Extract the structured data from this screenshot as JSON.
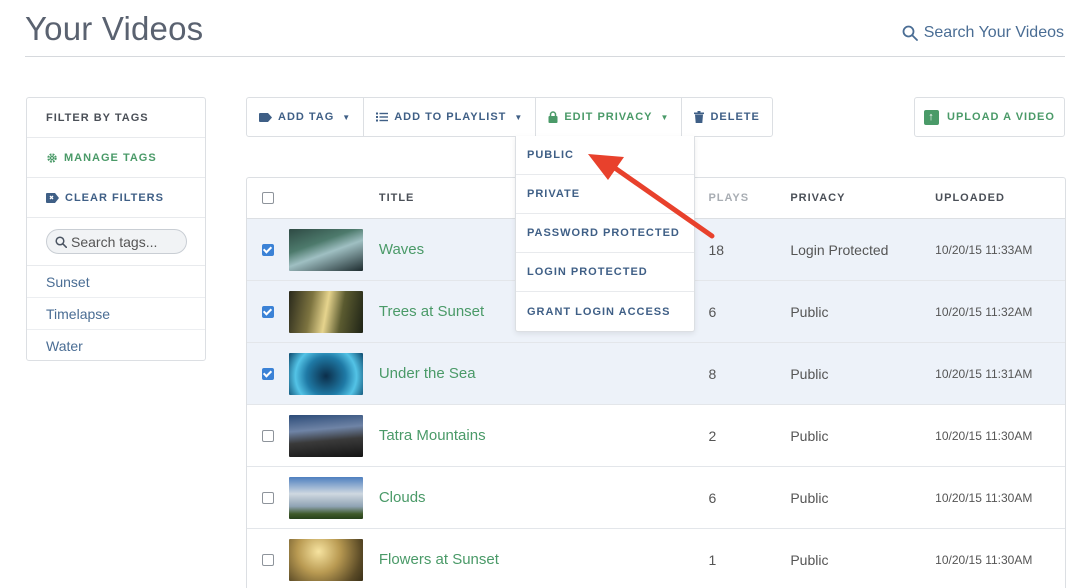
{
  "header": {
    "title": "Your Videos",
    "search_label": "Search Your Videos"
  },
  "sidebar": {
    "heading": "FILTER BY TAGS",
    "manage_tags": "MANAGE TAGS",
    "clear_filters": "CLEAR FILTERS",
    "search_placeholder": "Search tags...",
    "tags": [
      "Sunset",
      "Timelapse",
      "Water"
    ]
  },
  "toolbar": {
    "add_tag": "ADD TAG",
    "add_to_playlist": "ADD TO PLAYLIST",
    "edit_privacy": "EDIT PRIVACY",
    "delete": "DELETE",
    "upload": "UPLOAD A VIDEO"
  },
  "privacy_menu": {
    "items": [
      "PUBLIC",
      "PRIVATE",
      "PASSWORD PROTECTED",
      "LOGIN PROTECTED",
      "GRANT LOGIN ACCESS"
    ]
  },
  "table": {
    "headers": {
      "title": "TITLE",
      "plays": "PLAYS",
      "privacy": "PRIVACY",
      "uploaded": "UPLOADED"
    },
    "rows": [
      {
        "title": "Waves",
        "plays": "18",
        "privacy": "Login Protected",
        "uploaded": "10/20/15 11:33AM",
        "selected": true
      },
      {
        "title": "Trees at Sunset",
        "plays": "6",
        "privacy": "Public",
        "uploaded": "10/20/15 11:32AM",
        "selected": true
      },
      {
        "title": "Under the Sea",
        "plays": "8",
        "privacy": "Public",
        "uploaded": "10/20/15 11:31AM",
        "selected": true
      },
      {
        "title": "Tatra Mountains",
        "plays": "2",
        "privacy": "Public",
        "uploaded": "10/20/15 11:30AM",
        "selected": false
      },
      {
        "title": "Clouds",
        "plays": "6",
        "privacy": "Public",
        "uploaded": "10/20/15 11:30AM",
        "selected": false
      },
      {
        "title": "Flowers at Sunset",
        "plays": "1",
        "privacy": "Public",
        "uploaded": "10/20/15 11:30AM",
        "selected": false
      }
    ]
  },
  "colors": {
    "accent_green": "#4a9a68",
    "link_blue": "#3f5f86",
    "checkbox_blue": "#3b82d6",
    "selected_row": "#edf2f9",
    "annotation_arrow": "#e8412c"
  }
}
